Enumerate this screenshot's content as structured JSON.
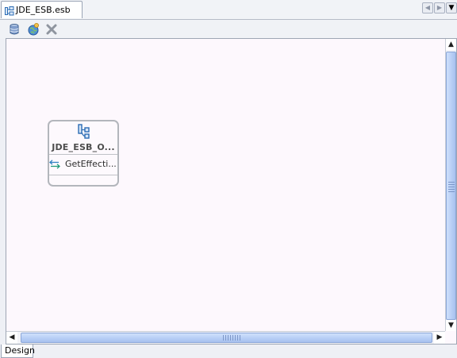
{
  "editor": {
    "tab": {
      "label": "JDE_ESB.esb",
      "icon": "esb-file-icon"
    },
    "nav": {
      "left_icon": "chevron-left-icon",
      "right_icon": "chevron-right-icon",
      "menu_icon": "dropdown-icon"
    }
  },
  "toolbar": {
    "tools": [
      {
        "icon": "database-icon"
      },
      {
        "icon": "globe-service-icon"
      },
      {
        "icon": "delete-icon"
      }
    ]
  },
  "diagram": {
    "node": {
      "title": "JDE_ESB_O...",
      "icon": "esb-service-icon",
      "operations": [
        {
          "label": "GetEffecti...",
          "icon": "exchange-arrows-icon"
        }
      ]
    }
  },
  "bottom_tabs": [
    {
      "label": "Design"
    }
  ],
  "colors": {
    "canvas_bg": "#fdf8fd",
    "scroll_thumb": "#b6cdf5",
    "node_border": "#b3b6bc",
    "icon_blue": "#3a7fc1"
  }
}
